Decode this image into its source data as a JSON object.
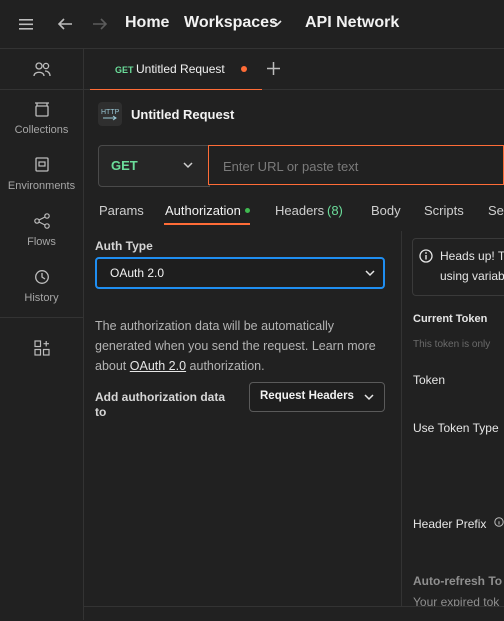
{
  "topbar": {
    "nav": [
      "Home",
      "Workspaces",
      "API Network"
    ]
  },
  "sidebar": {
    "items": [
      {
        "label": ""
      },
      {
        "label": "Collections"
      },
      {
        "label": "Environments"
      },
      {
        "label": "Flows"
      },
      {
        "label": "History"
      },
      {
        "label": ""
      }
    ]
  },
  "tab": {
    "method": "GET",
    "title": "Untitled Request"
  },
  "request": {
    "title": "Untitled Request",
    "method": "GET",
    "url_placeholder": "Enter URL or paste text"
  },
  "req_tabs": {
    "params": "Params",
    "authorization": "Authorization",
    "headers": "Headers",
    "headers_count": "(8)",
    "body": "Body",
    "scripts": "Scripts",
    "settings": "Set"
  },
  "auth": {
    "type_label": "Auth Type",
    "type_value": "OAuth 2.0",
    "desc_1": "The authorization data will be automatically",
    "desc_2": "generated when you send the request. Learn more",
    "desc_3a": "about ",
    "desc_link": "OAuth 2.0",
    "desc_3b": " authorization.",
    "add_label_1": "Add authorization data",
    "add_label_2": "to",
    "add_button": "Request Headers"
  },
  "right_panel": {
    "info_line1": "Heads up! T",
    "info_line2": "using variab",
    "current_token": "Current Token",
    "token_note": "This token is only",
    "token": "Token",
    "use_token_type": "Use Token Type",
    "header_prefix": "Header Prefix",
    "auto_refresh": "Auto-refresh To",
    "expired": "Your expired tok"
  },
  "colors": {
    "accent": "#ff6c37",
    "get": "#6bdd9a",
    "focus": "#1f8ef1",
    "ok": "#3fb950"
  }
}
